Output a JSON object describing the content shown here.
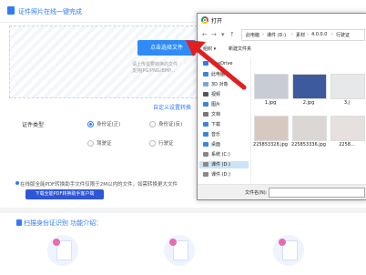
{
  "page": {
    "title": "证件照片在线一键完成",
    "upload_button": "点击选择文件",
    "upload_tip_1": "请上传需要转换的文件",
    "upload_tip_2": "支持JPG/PNG/BMP...",
    "custom_link": "自定义设置转换",
    "id_type_label": "证件类型",
    "options": [
      {
        "label": "身份证(正)",
        "selected": true
      },
      {
        "label": "身份证(反)",
        "selected": false
      },
      {
        "label": "驾驶证",
        "selected": false
      },
      {
        "label": "行驶证",
        "selected": false
      }
    ],
    "notice": "在线版全能PDF转换助手文件仅限于2M以内的文件，如需转换更大文件",
    "download_button": "下载全能PDF转换助手客户端",
    "section_title": "扫描身份证识别 功能介绍："
  },
  "dialog": {
    "title": "打开",
    "breadcrumb": [
      "此电脑",
      "课件 (D:)",
      "素材",
      "4.0.0.0",
      "行驶证"
    ],
    "toolbar": {
      "organize": "组织 ▾",
      "new_folder": "新建文件夹"
    },
    "sidebar": [
      {
        "label": "OneDrive",
        "icon": "cloud-icon",
        "color": "#2f7cf6",
        "selected": false
      },
      {
        "label": "此电脑",
        "icon": "computer-icon",
        "color": "#3a87d6",
        "selected": false
      },
      {
        "label": "3D 对象",
        "icon": "cube-icon",
        "color": "#7aa7d9",
        "selected": false
      },
      {
        "label": "视频",
        "icon": "video-icon",
        "color": "#555",
        "selected": false
      },
      {
        "label": "图片",
        "icon": "picture-icon",
        "color": "#3a87d6",
        "selected": false
      },
      {
        "label": "文档",
        "icon": "document-icon",
        "color": "#777",
        "selected": false
      },
      {
        "label": "下载",
        "icon": "download-icon",
        "color": "#3a87d6",
        "selected": false
      },
      {
        "label": "音乐",
        "icon": "music-icon",
        "color": "#3a87d6",
        "selected": false
      },
      {
        "label": "桌面",
        "icon": "desktop-icon",
        "color": "#3a87d6",
        "selected": false
      },
      {
        "label": "系统 (C:)",
        "icon": "drive-icon",
        "color": "#888",
        "selected": false
      },
      {
        "label": "课件 (D:)",
        "icon": "drive-icon",
        "color": "#888",
        "selected": true
      },
      {
        "label": "课件 (D:)",
        "icon": "drive-icon",
        "color": "#888",
        "selected": false
      }
    ],
    "files": [
      {
        "name": "1.jpg",
        "tone": "#c8ccd4"
      },
      {
        "name": "2.jpg",
        "tone": "#3d5a9e"
      },
      {
        "name": "3.j",
        "tone": "#e7e8ea"
      },
      {
        "name": "225853328.jpg",
        "tone": "#d8c9c0"
      },
      {
        "name": "225853336.jpg",
        "tone": "#dcd6d4"
      },
      {
        "name": "2258...",
        "tone": "#e6e0df"
      }
    ],
    "filename_label": "文件名(N):"
  }
}
